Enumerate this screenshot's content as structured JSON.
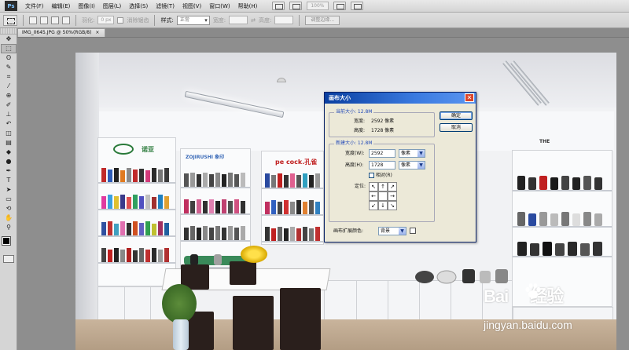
{
  "app": {
    "logo": "Ps",
    "menu": [
      "文件(F)",
      "编辑(E)",
      "图像(I)",
      "图层(L)",
      "选择(S)",
      "滤镜(T)",
      "视图(V)",
      "窗口(W)",
      "帮助(H)"
    ],
    "zoom_display": "100%"
  },
  "options": {
    "feather_label": "羽化:",
    "feather_value": "0 px",
    "antialias_label": "消除锯齿",
    "style_label": "样式:",
    "style_value": "正常",
    "width_label": "宽度:",
    "height_label": "高度:",
    "refine_button": "调整边缘..."
  },
  "document": {
    "tab_title": "IMG_0645.JPG @ 50%(RGB/8)",
    "tab_close": "×"
  },
  "photo": {
    "sign_brand_left": "诺亚",
    "sign_brand_mid": "ZOJIRUSHI 象印",
    "sign_brand_peacock": "pe cock.孔雀",
    "sign_brand_right": "THE"
  },
  "watermark": {
    "brand_part1": "Bai",
    "brand_part2": "经验",
    "url": "jingyan.baidu.com"
  },
  "dialog": {
    "title": "画布大小",
    "close": "✕",
    "current": {
      "group_label": "当前大小: 12.8M",
      "width_label": "宽度:",
      "width_value": "2592 像素",
      "height_label": "高度:",
      "height_value": "1728 像素"
    },
    "new": {
      "group_label": "新建大小: 12.8M",
      "width_label": "宽度(W):",
      "width_value": "2592",
      "width_unit": "像素",
      "height_label": "高度(H):",
      "height_value": "1728",
      "height_unit": "像素",
      "relative_label": "相对(R)",
      "anchor_label": "定位:",
      "anchor_arrows": [
        "↖",
        "↑",
        "↗",
        "←",
        "",
        "→",
        "↙",
        "↓",
        "↘"
      ]
    },
    "ext_color_label": "画布扩展颜色:",
    "ext_color_value": "背景",
    "ok_button": "确定",
    "cancel_button": "取消"
  }
}
